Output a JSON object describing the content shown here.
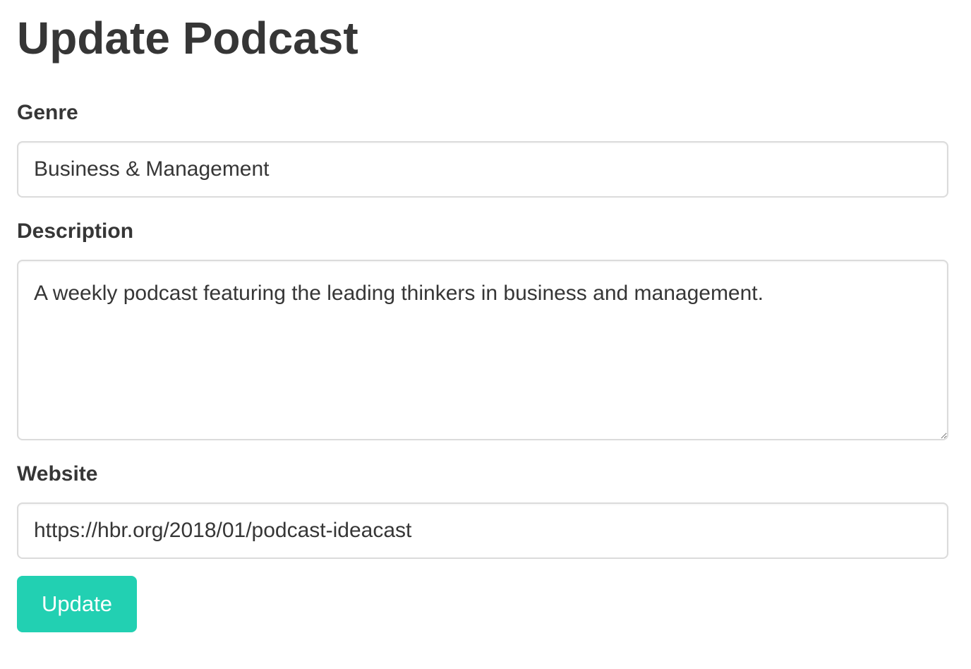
{
  "page": {
    "title": "Update Podcast"
  },
  "form": {
    "genre": {
      "label": "Genre",
      "value": "Business & Management"
    },
    "description": {
      "label": "Description",
      "value": "A weekly podcast featuring the leading thinkers in business and management."
    },
    "website": {
      "label": "Website",
      "value": "https://hbr.org/2018/01/podcast-ideacast"
    },
    "submit_label": "Update"
  },
  "colors": {
    "primary": "#22d0b2",
    "text": "#363636",
    "border": "#dbdbdb"
  }
}
